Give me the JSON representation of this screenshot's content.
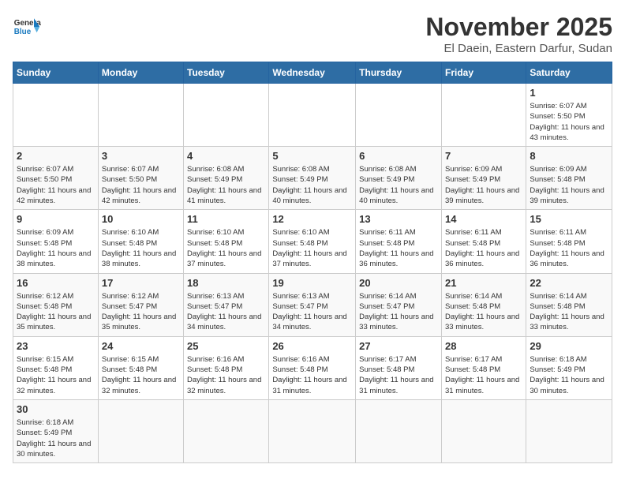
{
  "header": {
    "logo_general": "General",
    "logo_blue": "Blue",
    "month_title": "November 2025",
    "location": "El Daein, Eastern Darfur, Sudan"
  },
  "weekdays": [
    "Sunday",
    "Monday",
    "Tuesday",
    "Wednesday",
    "Thursday",
    "Friday",
    "Saturday"
  ],
  "weeks": [
    [
      {
        "day": "",
        "info": ""
      },
      {
        "day": "",
        "info": ""
      },
      {
        "day": "",
        "info": ""
      },
      {
        "day": "",
        "info": ""
      },
      {
        "day": "",
        "info": ""
      },
      {
        "day": "",
        "info": ""
      },
      {
        "day": "1",
        "info": "Sunrise: 6:07 AM\nSunset: 5:50 PM\nDaylight: 11 hours\nand 43 minutes."
      }
    ],
    [
      {
        "day": "2",
        "info": "Sunrise: 6:07 AM\nSunset: 5:50 PM\nDaylight: 11 hours\nand 42 minutes."
      },
      {
        "day": "3",
        "info": "Sunrise: 6:07 AM\nSunset: 5:50 PM\nDaylight: 11 hours\nand 42 minutes."
      },
      {
        "day": "4",
        "info": "Sunrise: 6:08 AM\nSunset: 5:49 PM\nDaylight: 11 hours\nand 41 minutes."
      },
      {
        "day": "5",
        "info": "Sunrise: 6:08 AM\nSunset: 5:49 PM\nDaylight: 11 hours\nand 40 minutes."
      },
      {
        "day": "6",
        "info": "Sunrise: 6:08 AM\nSunset: 5:49 PM\nDaylight: 11 hours\nand 40 minutes."
      },
      {
        "day": "7",
        "info": "Sunrise: 6:09 AM\nSunset: 5:49 PM\nDaylight: 11 hours\nand 39 minutes."
      },
      {
        "day": "8",
        "info": "Sunrise: 6:09 AM\nSunset: 5:48 PM\nDaylight: 11 hours\nand 39 minutes."
      }
    ],
    [
      {
        "day": "9",
        "info": "Sunrise: 6:09 AM\nSunset: 5:48 PM\nDaylight: 11 hours\nand 38 minutes."
      },
      {
        "day": "10",
        "info": "Sunrise: 6:10 AM\nSunset: 5:48 PM\nDaylight: 11 hours\nand 38 minutes."
      },
      {
        "day": "11",
        "info": "Sunrise: 6:10 AM\nSunset: 5:48 PM\nDaylight: 11 hours\nand 37 minutes."
      },
      {
        "day": "12",
        "info": "Sunrise: 6:10 AM\nSunset: 5:48 PM\nDaylight: 11 hours\nand 37 minutes."
      },
      {
        "day": "13",
        "info": "Sunrise: 6:11 AM\nSunset: 5:48 PM\nDaylight: 11 hours\nand 36 minutes."
      },
      {
        "day": "14",
        "info": "Sunrise: 6:11 AM\nSunset: 5:48 PM\nDaylight: 11 hours\nand 36 minutes."
      },
      {
        "day": "15",
        "info": "Sunrise: 6:11 AM\nSunset: 5:48 PM\nDaylight: 11 hours\nand 36 minutes."
      }
    ],
    [
      {
        "day": "16",
        "info": "Sunrise: 6:12 AM\nSunset: 5:48 PM\nDaylight: 11 hours\nand 35 minutes."
      },
      {
        "day": "17",
        "info": "Sunrise: 6:12 AM\nSunset: 5:47 PM\nDaylight: 11 hours\nand 35 minutes."
      },
      {
        "day": "18",
        "info": "Sunrise: 6:13 AM\nSunset: 5:47 PM\nDaylight: 11 hours\nand 34 minutes."
      },
      {
        "day": "19",
        "info": "Sunrise: 6:13 AM\nSunset: 5:47 PM\nDaylight: 11 hours\nand 34 minutes."
      },
      {
        "day": "20",
        "info": "Sunrise: 6:14 AM\nSunset: 5:47 PM\nDaylight: 11 hours\nand 33 minutes."
      },
      {
        "day": "21",
        "info": "Sunrise: 6:14 AM\nSunset: 5:48 PM\nDaylight: 11 hours\nand 33 minutes."
      },
      {
        "day": "22",
        "info": "Sunrise: 6:14 AM\nSunset: 5:48 PM\nDaylight: 11 hours\nand 33 minutes."
      }
    ],
    [
      {
        "day": "23",
        "info": "Sunrise: 6:15 AM\nSunset: 5:48 PM\nDaylight: 11 hours\nand 32 minutes."
      },
      {
        "day": "24",
        "info": "Sunrise: 6:15 AM\nSunset: 5:48 PM\nDaylight: 11 hours\nand 32 minutes."
      },
      {
        "day": "25",
        "info": "Sunrise: 6:16 AM\nSunset: 5:48 PM\nDaylight: 11 hours\nand 32 minutes."
      },
      {
        "day": "26",
        "info": "Sunrise: 6:16 AM\nSunset: 5:48 PM\nDaylight: 11 hours\nand 31 minutes."
      },
      {
        "day": "27",
        "info": "Sunrise: 6:17 AM\nSunset: 5:48 PM\nDaylight: 11 hours\nand 31 minutes."
      },
      {
        "day": "28",
        "info": "Sunrise: 6:17 AM\nSunset: 5:48 PM\nDaylight: 11 hours\nand 31 minutes."
      },
      {
        "day": "29",
        "info": "Sunrise: 6:18 AM\nSunset: 5:49 PM\nDaylight: 11 hours\nand 30 minutes."
      }
    ],
    [
      {
        "day": "30",
        "info": "Sunrise: 6:18 AM\nSunset: 5:49 PM\nDaylight: 11 hours\nand 30 minutes."
      },
      {
        "day": "",
        "info": ""
      },
      {
        "day": "",
        "info": ""
      },
      {
        "day": "",
        "info": ""
      },
      {
        "day": "",
        "info": ""
      },
      {
        "day": "",
        "info": ""
      },
      {
        "day": "",
        "info": ""
      }
    ]
  ]
}
